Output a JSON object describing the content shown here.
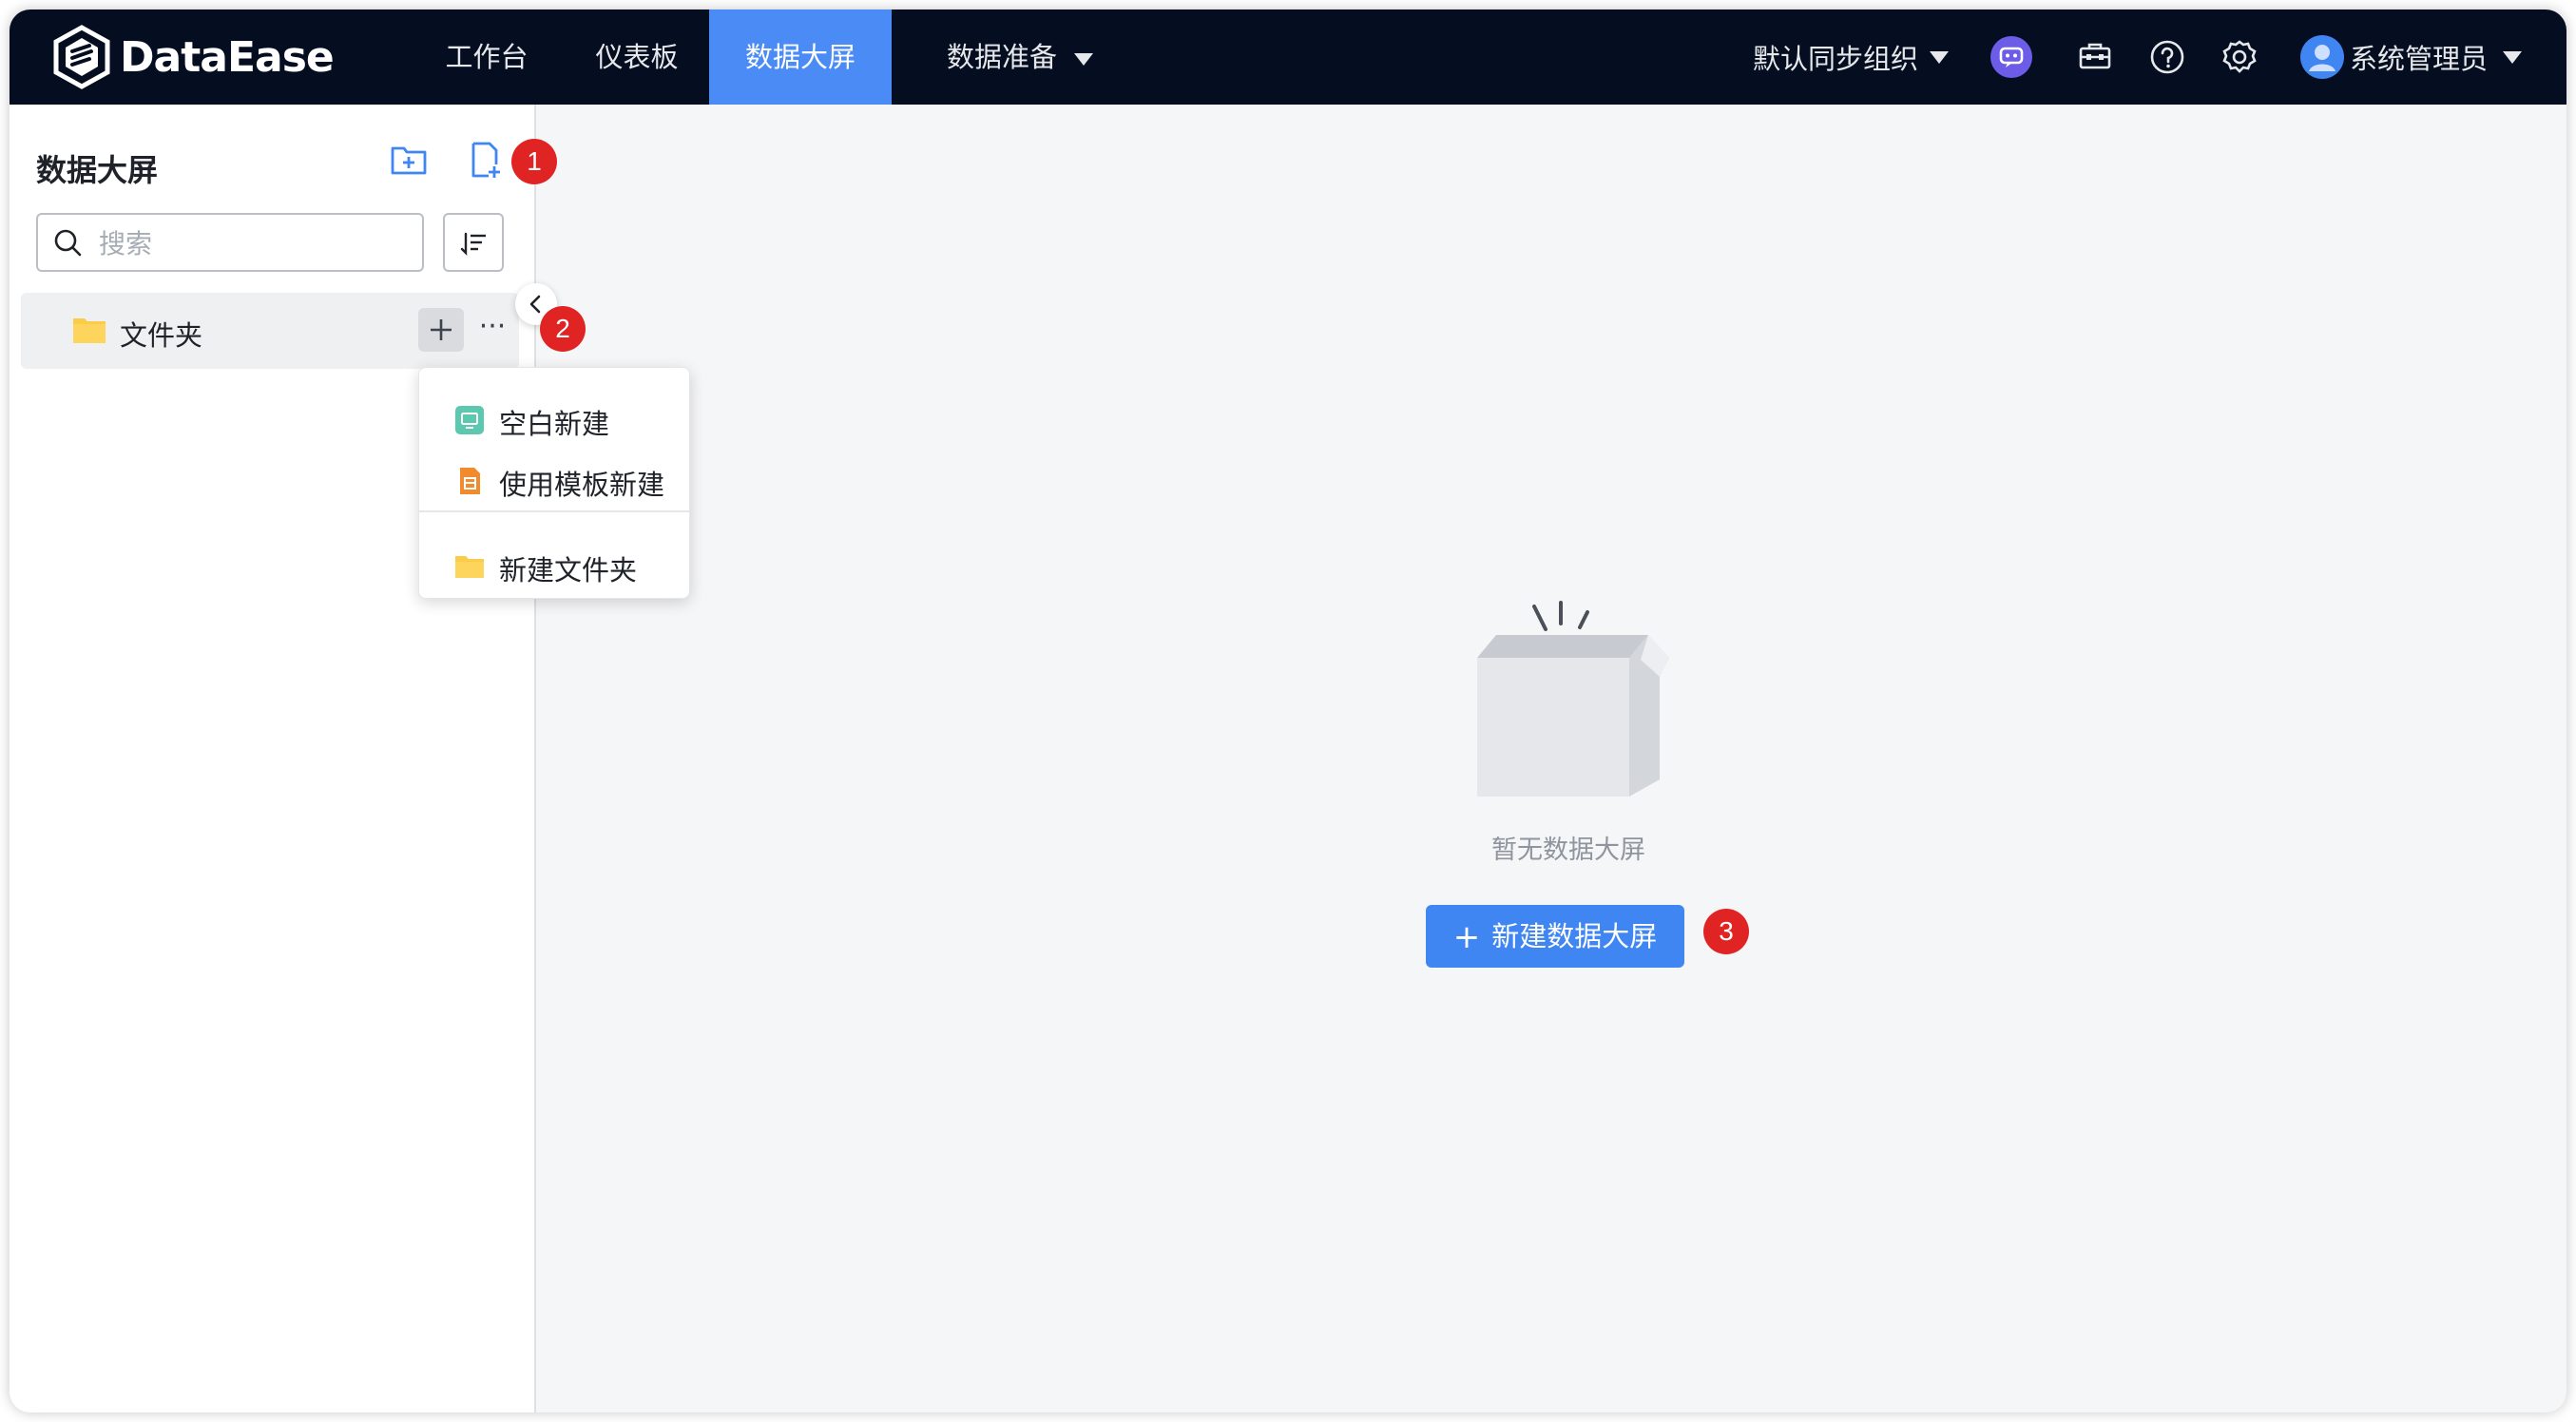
{
  "app": {
    "logo_text": "DataEase"
  },
  "nav": {
    "items": [
      {
        "label": "工作台"
      },
      {
        "label": "仪表板"
      },
      {
        "label": "数据大屏"
      },
      {
        "label": "数据准备"
      }
    ],
    "active": "数据大屏"
  },
  "header": {
    "org_label": "默认同步组织",
    "user_label": "系统管理员",
    "icons": [
      "ai-chat-icon",
      "toolbox-icon",
      "help-icon",
      "gear-icon",
      "avatar"
    ]
  },
  "sidebar": {
    "title": "数据大屏",
    "search_placeholder": "搜索",
    "tree": [
      {
        "label": "文件夹",
        "icon": "folder-icon"
      }
    ]
  },
  "menu": {
    "items": [
      {
        "label": "空白新建",
        "icon": "blank-screen-icon"
      },
      {
        "label": "使用模板新建",
        "icon": "template-icon"
      },
      {
        "label": "新建文件夹",
        "icon": "folder-icon"
      }
    ]
  },
  "main": {
    "empty_text": "暂无数据大屏",
    "create_button": "新建数据大屏"
  },
  "badges": [
    "1",
    "2",
    "3"
  ],
  "colors": {
    "header_bg": "#050e21",
    "accent": "#3f86f2",
    "badge": "#e02424",
    "folder": "#fbcb4a"
  }
}
